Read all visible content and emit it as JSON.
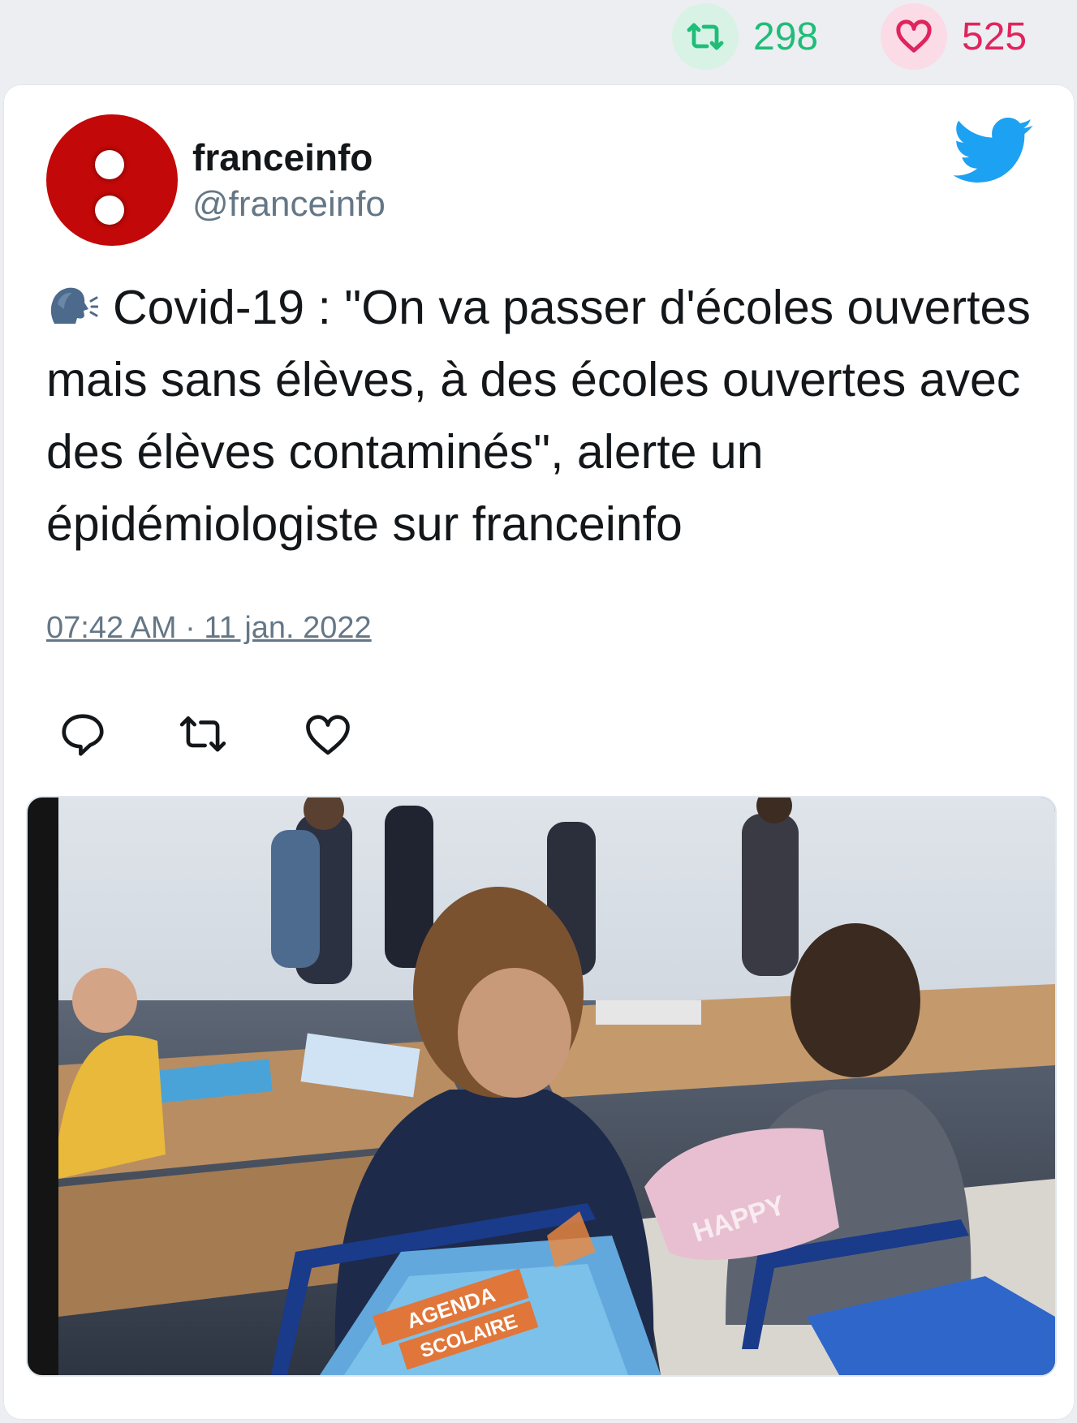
{
  "stats": {
    "retweets": "298",
    "likes": "525",
    "retweet_icon": "retweet-icon",
    "like_icon": "heart-icon"
  },
  "author": {
    "name": "franceinfo",
    "handle": "@franceinfo",
    "avatar_icon": "franceinfo-logo"
  },
  "tweet": {
    "emoji": "speaking-head-icon",
    "text": "Covid-19 : \"On va passer d'écoles ouvertes mais sans élèves, à des écoles ouvertes avec des élèves contaminés\", alerte un épidémiologiste sur franceinfo",
    "timestamp": "07:42 AM · 11 jan. 2022"
  },
  "photo": {
    "subject": "classroom-photo",
    "agenda_line1": "AGENDA",
    "agenda_line2": "SCOLAIRE",
    "pencil_case_text": "HAPPY"
  },
  "colors": {
    "retweet": "#1fbd78",
    "like": "#e0245e",
    "twitter_blue": "#1da1f2",
    "avatar_red": "#c20808"
  }
}
